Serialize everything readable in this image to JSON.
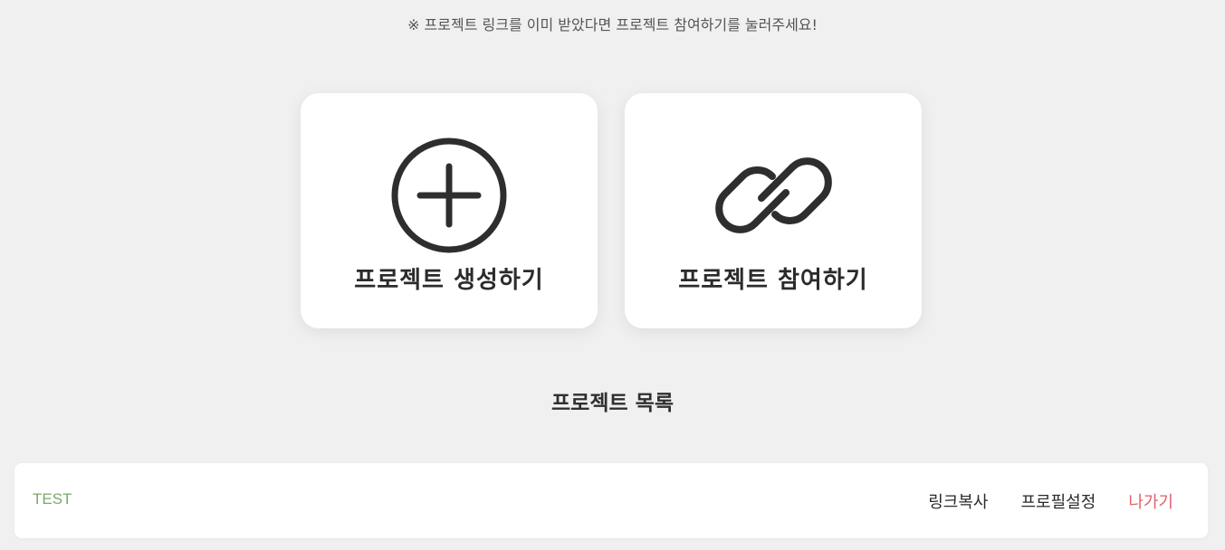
{
  "notice": "※ 프로젝트 링크를 이미 받았다면 프로젝트 참여하기를 눌러주세요!",
  "cards": {
    "create": {
      "label": "프로젝트 생성하기",
      "icon": "plus-circle-icon"
    },
    "join": {
      "label": "프로젝트 참여하기",
      "icon": "link-icon"
    }
  },
  "project_list": {
    "title": "프로젝트 목록",
    "items": [
      {
        "name": "TEST",
        "copy_link": "링크복사",
        "profile_settings": "프로필설정",
        "leave": "나가기"
      }
    ]
  },
  "colors": {
    "background": "#f0f0f0",
    "project_name": "#7ba86a",
    "leave": "#e2606a",
    "icon_stroke": "#2e2e2e"
  }
}
